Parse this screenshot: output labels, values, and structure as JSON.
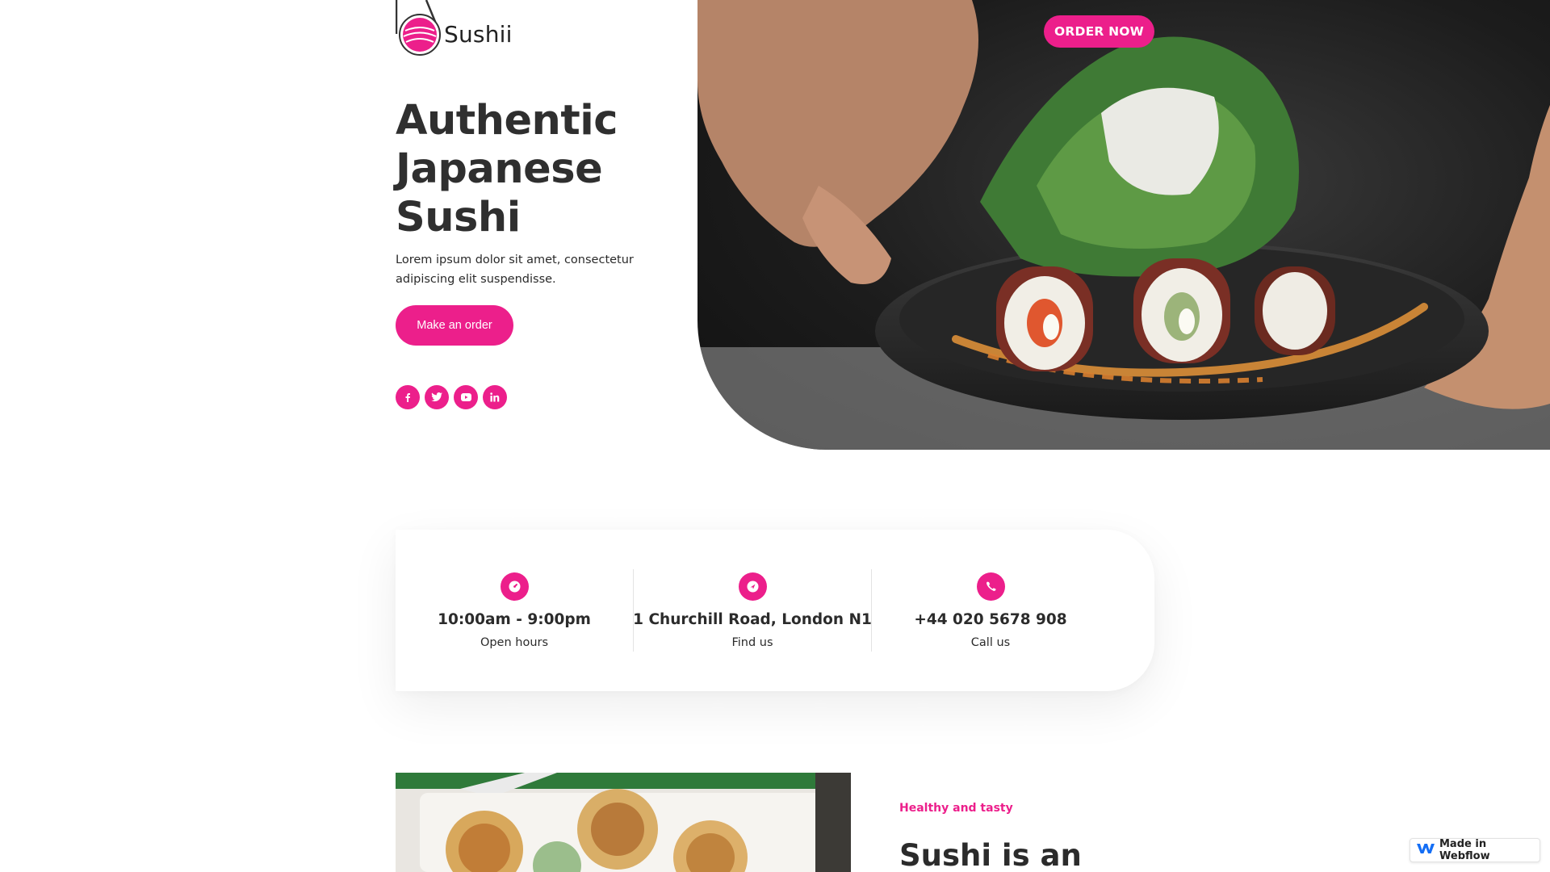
{
  "brand": {
    "name": "Sushii"
  },
  "hero": {
    "title_lines": [
      "Authentic",
      "Japanese",
      "Sushi"
    ],
    "description": "Lorem ipsum dolor sit amet, consectetur adipiscing elit suspendisse.",
    "cta_label": "Make an order",
    "order_now_label": "ORDER NOW",
    "image_alt": "sushi-plate-photo"
  },
  "socials": [
    "facebook-icon",
    "twitter-icon",
    "youtube-icon",
    "linkedin-icon"
  ],
  "info": [
    {
      "icon": "clock-icon",
      "value": "10:00am - 9:00pm",
      "label": "Open hours"
    },
    {
      "icon": "location-icon",
      "value": "1 Churchill Road, London N1",
      "label": "Find us"
    },
    {
      "icon": "phone-icon",
      "value": "+44 020 5678 908",
      "label": "Call us"
    }
  ],
  "section": {
    "kicker": "Healthy and tasty",
    "title": "Sushi is an"
  },
  "badge": {
    "label": "Made in Webflow"
  },
  "colors": {
    "accent": "#ec1f8b",
    "text": "#2b2b2b",
    "background": "#ffffff"
  }
}
